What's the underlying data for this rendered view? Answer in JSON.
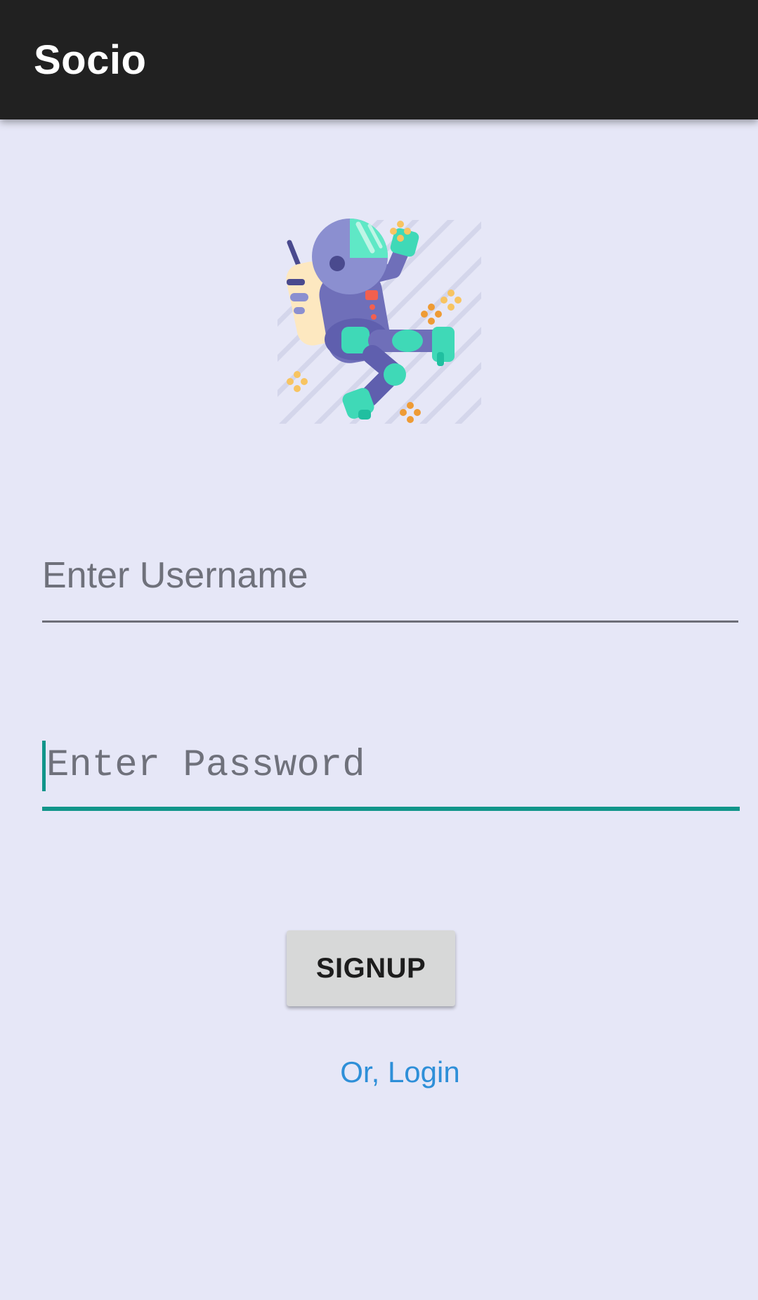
{
  "app_bar": {
    "title": "Socio"
  },
  "hero": {
    "icon": "astronaut-illustration"
  },
  "form": {
    "username_placeholder": "Enter Username",
    "password_placeholder": "Enter Password"
  },
  "actions": {
    "signup_label": "SIGNUP",
    "login_link_label": "Or, Login"
  },
  "colors": {
    "app_bar": "#212121",
    "background": "#e6e7f7",
    "accent": "#11958a",
    "link": "#2e8fd8",
    "button": "#d7d8d8"
  }
}
